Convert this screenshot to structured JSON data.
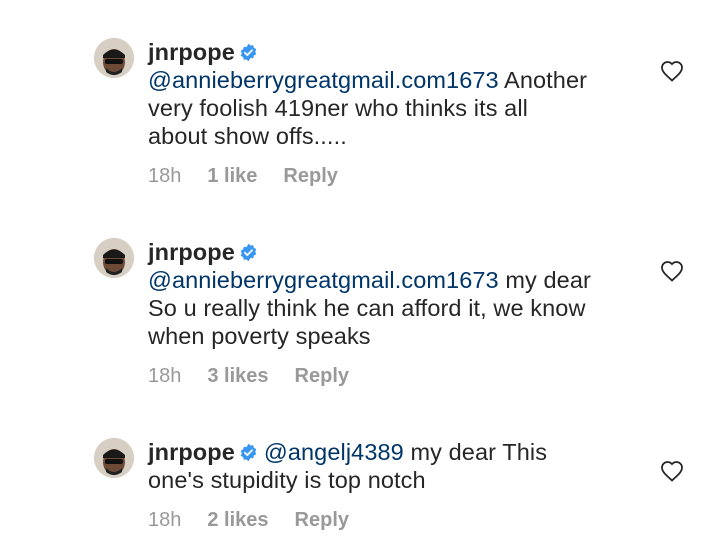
{
  "comments": [
    {
      "username": "jnrpope",
      "mention": "@annieberrygreatgmail.com1673",
      "text_line1": " Another",
      "text_rest": "very foolish 419ner who thinks its all about show offs.....",
      "time": "18h",
      "likes": "1 like",
      "reply": "Reply"
    },
    {
      "username": "jnrpope",
      "mention": "@annieberrygreatgmail.com1673",
      "text_line1": " my dear",
      "text_rest": "So u really think he can afford it, we know when poverty speaks",
      "time": "18h",
      "likes": "3 likes",
      "reply": "Reply"
    },
    {
      "username": "jnrpope",
      "mention": "@angelj4389",
      "text_line1": " my dear This",
      "text_rest": "one's stupidity is top notch",
      "time": "18h",
      "likes": "2 likes",
      "reply": "Reply"
    }
  ],
  "icons": {
    "avatar": "avatar",
    "verified": "verified-badge-icon",
    "like": "heart-outline-icon"
  },
  "colors": {
    "text": "#262626",
    "mention": "#003569",
    "meta": "#999999",
    "verified": "#3897f0"
  }
}
